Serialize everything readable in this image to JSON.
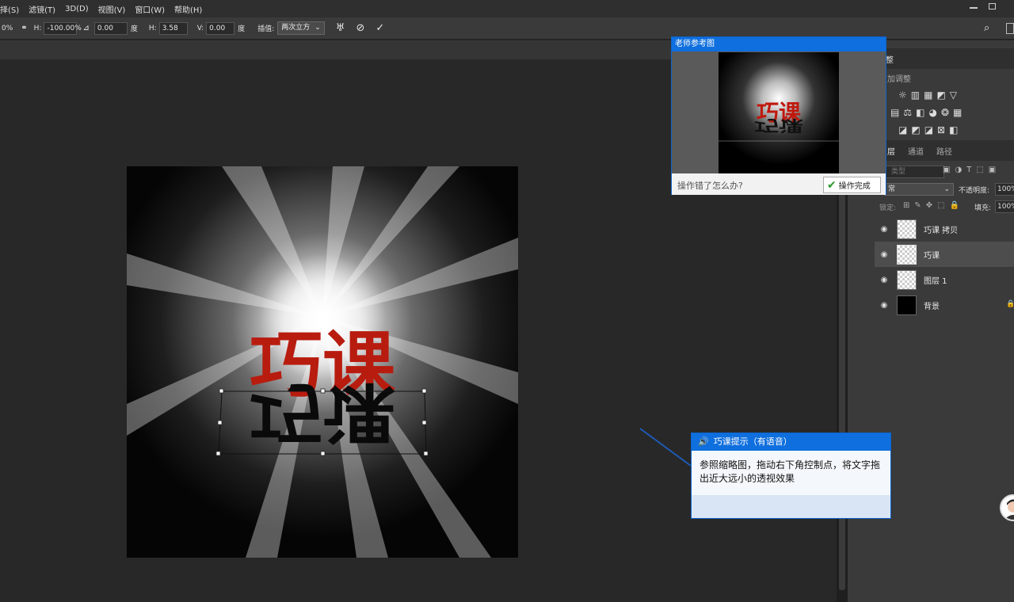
{
  "menubar": {
    "items": [
      "择(S)",
      "滤镜(T)",
      "3D(D)",
      "视图(V)",
      "窗口(W)",
      "帮助(H)"
    ]
  },
  "options": {
    "percent": "0%",
    "h_label": "H:",
    "h_value": "-100.00%",
    "angle_value": "0.00",
    "degree_1": "度",
    "hskew_label": "H:",
    "hskew_value": "3.58",
    "vskew_label": "V:",
    "vskew_value": "0.00",
    "degree_2": "度",
    "interp_label": "插值:",
    "interp_value": "两次立方"
  },
  "canvas": {
    "text_top": "巧课",
    "text_reflect": "巧课",
    "text_color": "#b81c0f"
  },
  "ref_popup": {
    "title": "老师参考图",
    "thumb_text": "巧课",
    "question": "操作错了怎么办?",
    "done_label": "操作完成"
  },
  "hint": {
    "title": "巧课提示（有语音）",
    "body": "参照缩略图，拖动右下角控制点，将文字拖出近大远小的透视效果"
  },
  "panel": {
    "tab_adjust": "整",
    "add_adjust": "加调整",
    "tab_layers": "层",
    "tab_channels": "通道",
    "tab_paths": "路径",
    "kind_placeholder": "类型",
    "blend_mode": "常",
    "opacity_label": "不透明度:",
    "opacity_value": "100%",
    "lock_label": "锁定:",
    "fill_label": "填充:",
    "fill_value": "100%"
  },
  "layers": [
    {
      "name": "巧课 拷贝"
    },
    {
      "name": "巧课"
    },
    {
      "name": "图层 1"
    },
    {
      "name": "背景"
    }
  ],
  "colors": {
    "accent_blue": "#0f6fde",
    "brand_red": "#b81c0f"
  }
}
